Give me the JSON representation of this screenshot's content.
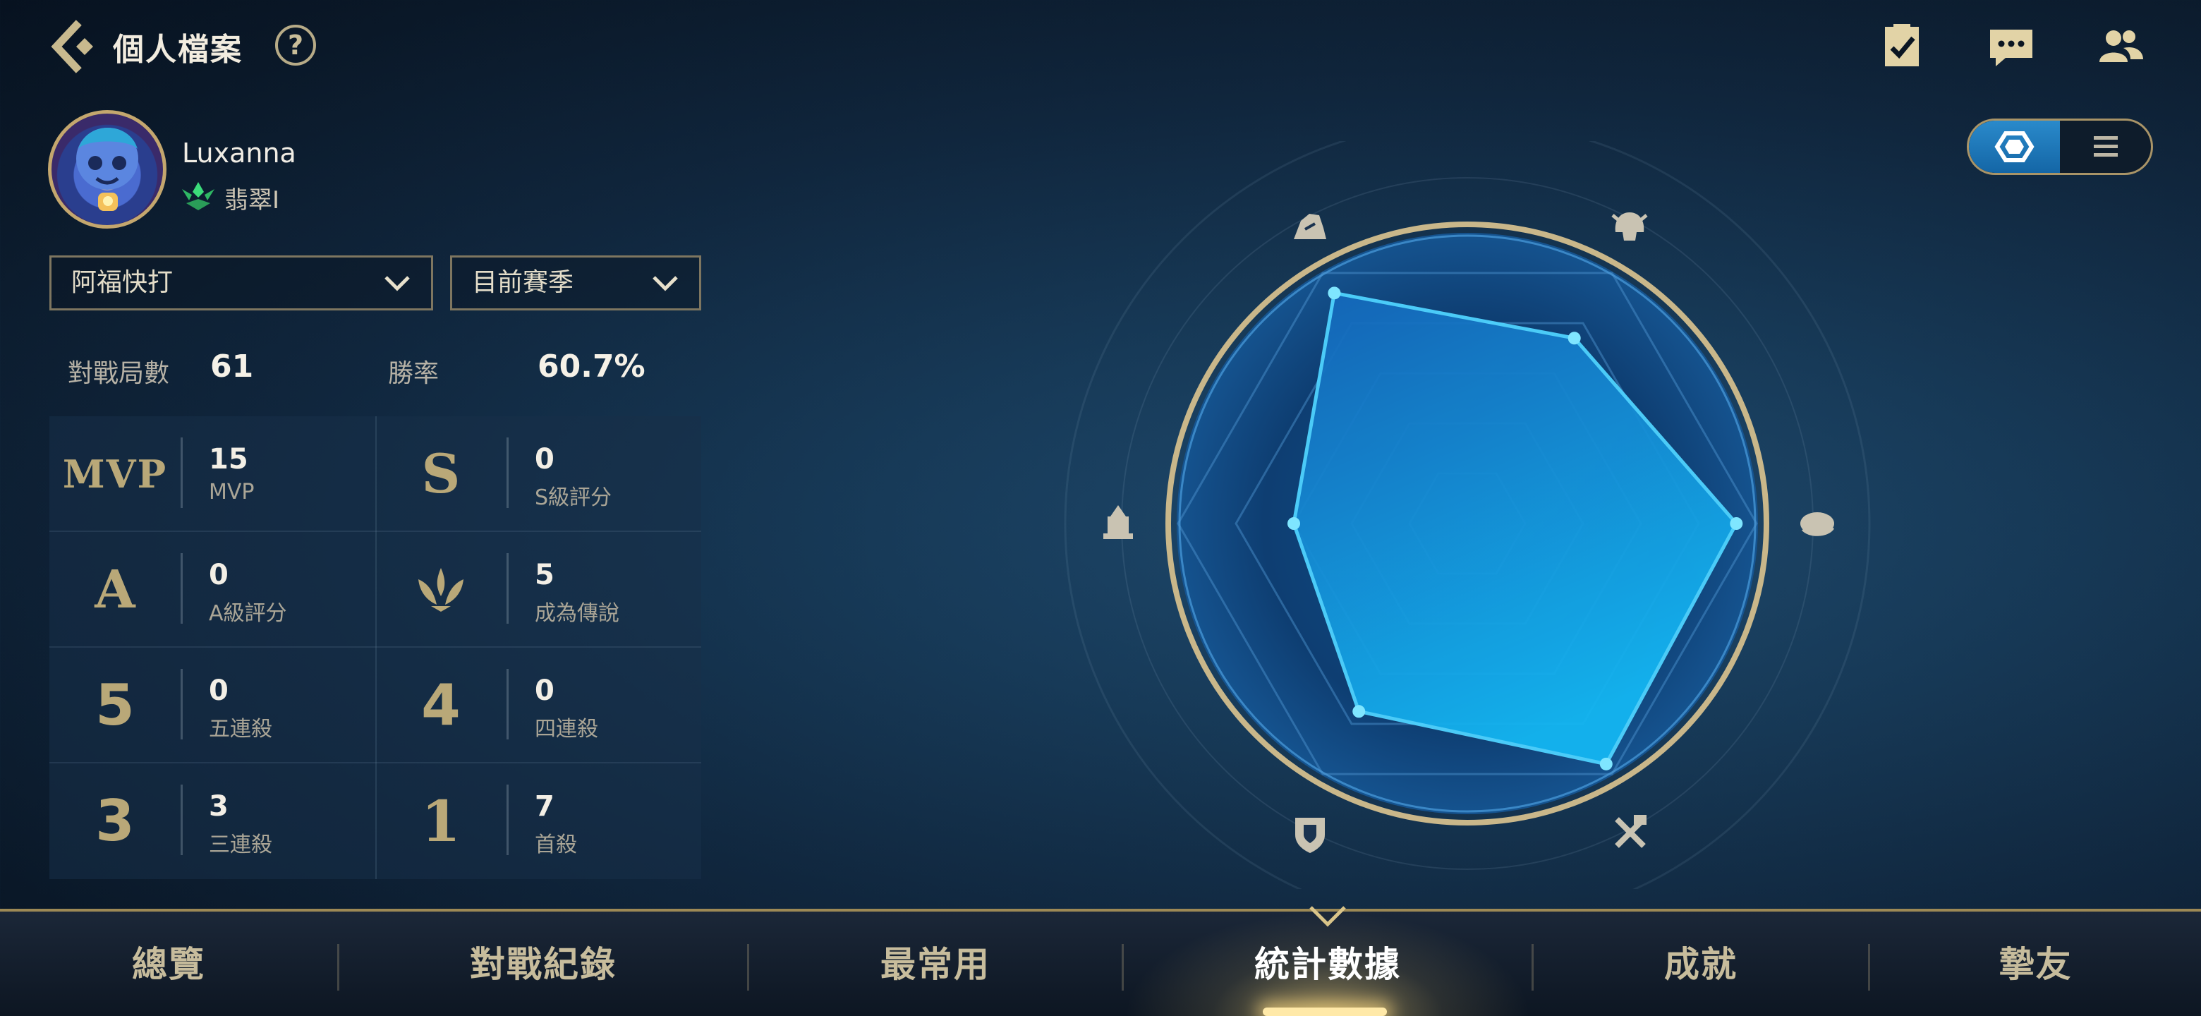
{
  "header": {
    "title": "個人檔案",
    "help_label": "?",
    "icons": [
      "back-arrow-icon",
      "help-icon",
      "checklist-icon",
      "chat-icon",
      "friends-icon"
    ]
  },
  "profile": {
    "name": "Luxanna",
    "rank": "翡翠Ⅰ"
  },
  "filters": {
    "mode": "阿福快打",
    "season": "目前賽季"
  },
  "summary": {
    "matches_label": "對戰局數",
    "matches_value": "61",
    "winrate_label": "勝率",
    "winrate_value": "60.7%"
  },
  "stats": [
    {
      "badge": "MVP",
      "value": "15",
      "label": "MVP"
    },
    {
      "badge": "S",
      "value": "0",
      "label": "S級評分"
    },
    {
      "badge": "A",
      "value": "0",
      "label": "A級評分"
    },
    {
      "badge": "legend-crown-icon",
      "value": "5",
      "label": "成為傳說"
    },
    {
      "badge": "5",
      "value": "0",
      "label": "五連殺"
    },
    {
      "badge": "4",
      "value": "0",
      "label": "四連殺"
    },
    {
      "badge": "3",
      "value": "3",
      "label": "三連殺"
    },
    {
      "badge": "1",
      "value": "7",
      "label": "首殺"
    }
  ],
  "radar": {
    "axes": [
      "assassin-icon",
      "fighter-icon",
      "mage-icon",
      "marksman-icon",
      "tank-icon",
      "support-icon"
    ],
    "values": [
      0.92,
      0.74,
      0.93,
      0.96,
      0.75,
      0.6
    ],
    "colors": {
      "fill": "#1aa3e8",
      "stroke": "#4fd3ff",
      "ring": "#c9b78a"
    }
  },
  "view_toggle": {
    "options": [
      "hexagon-view-icon",
      "list-view-icon"
    ],
    "selected": "hexagon-view-icon"
  },
  "nav": {
    "items": [
      "總覽",
      "對戰紀錄",
      "最常用",
      "統計數據",
      "成就",
      "摯友"
    ],
    "active": "統計數據"
  },
  "theme": {
    "gold": "#cdbf95",
    "accent": "#1aa3e8"
  }
}
